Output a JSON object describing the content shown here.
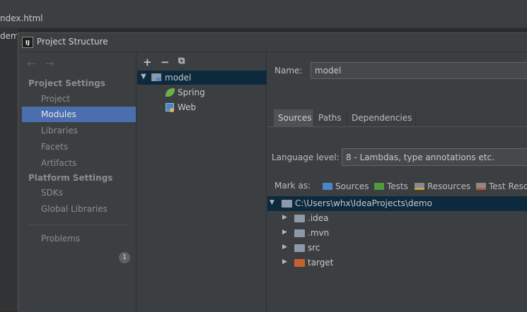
{
  "background": {
    "tabs": [
      {
        "label": "ndex.html"
      },
      {
        "label": "demo"
      }
    ]
  },
  "dialog": {
    "title": "Project Structure",
    "logo_text": "IJ"
  },
  "left_panel": {
    "sections": [
      {
        "heading": "Project Settings",
        "items": [
          "Project",
          "Modules",
          "Libraries",
          "Facets",
          "Artifacts"
        ]
      },
      {
        "heading": "Platform Settings",
        "items": [
          "SDKs",
          "Global Libraries"
        ]
      }
    ],
    "selected_item": "Modules",
    "problems_label": "Problems",
    "problems_count": "1"
  },
  "middle_panel": {
    "toolbar": [
      "+",
      "−",
      "⧉"
    ],
    "tree": [
      {
        "label": "model",
        "icon": "module-folder-icon",
        "level": 0,
        "expanded": true,
        "selected": true
      },
      {
        "label": "Spring",
        "icon": "spring-leaf-icon",
        "level": 1
      },
      {
        "label": "Web",
        "icon": "web-facet-icon",
        "level": 1
      }
    ]
  },
  "right_panel": {
    "name_label": "Name:",
    "name_value": "model",
    "tabs": [
      "Sources",
      "Paths",
      "Dependencies"
    ],
    "selected_tab": "Sources",
    "language_level_label": "Language level:",
    "language_level_value": "8 - Lambdas, type annotations etc.",
    "mark_as_label": "Mark as:",
    "mark_as_options": [
      {
        "label": "Sources",
        "color": "#4a87c9"
      },
      {
        "label": "Tests",
        "color": "#4f9a3d"
      },
      {
        "label": "Resources",
        "color": "#8a8a8a"
      },
      {
        "label": "Test Resources",
        "color": "#8a8a8a"
      }
    ],
    "content_tree": [
      {
        "label": "C:\\Users\\whx\\IdeaProjects\\demo",
        "expanded": true,
        "selected": true,
        "folder_color": "#8d99a6"
      },
      {
        "label": ".idea",
        "expanded": false,
        "folder_color": "#8d99a6"
      },
      {
        "label": ".mvn",
        "expanded": false,
        "folder_color": "#8d99a6"
      },
      {
        "label": "src",
        "expanded": false,
        "folder_color": "#8d99a6"
      },
      {
        "label": "target",
        "expanded": false,
        "folder_color": "#c5612d"
      }
    ]
  },
  "colors": {
    "selection_blue": "#4b6eaf",
    "tree_selection": "#0d293e",
    "panel_bg": "#3c3f41"
  }
}
